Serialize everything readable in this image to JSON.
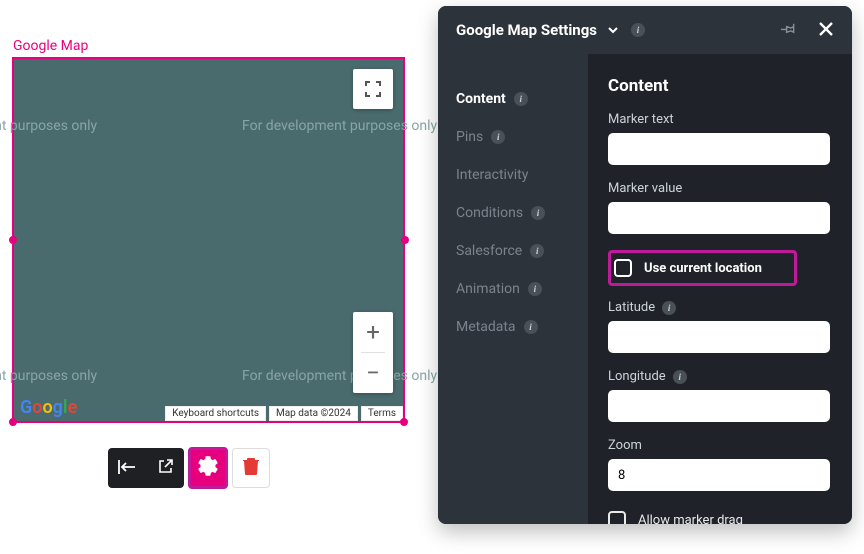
{
  "widget": {
    "label": "Google Map"
  },
  "watermark": "For development purposes only",
  "mapFooter": {
    "shortcuts": "Keyboard shortcuts",
    "data": "Map data ©2024",
    "terms": "Terms"
  },
  "googleLogo": [
    "G",
    "o",
    "o",
    "g",
    "l",
    "e"
  ],
  "panel": {
    "title": "Google Map Settings",
    "nav": {
      "content": "Content",
      "pins": "Pins",
      "interactivity": "Interactivity",
      "conditions": "Conditions",
      "salesforce": "Salesforce",
      "animation": "Animation",
      "metadata": "Metadata"
    },
    "section": {
      "title": "Content"
    },
    "fields": {
      "markerText": {
        "label": "Marker text",
        "value": ""
      },
      "markerValue": {
        "label": "Marker value",
        "value": ""
      },
      "useCurrent": {
        "label": "Use current location"
      },
      "latitude": {
        "label": "Latitude",
        "value": ""
      },
      "longitude": {
        "label": "Longitude",
        "value": ""
      },
      "zoom": {
        "label": "Zoom",
        "value": "8"
      },
      "allowDrag": {
        "label": "Allow marker drag"
      }
    }
  }
}
